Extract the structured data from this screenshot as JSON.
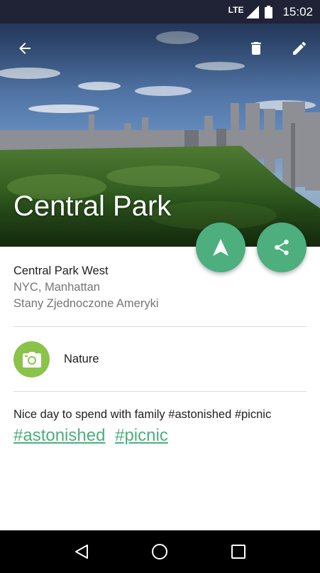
{
  "status_bar": {
    "network": "LTE",
    "time": "15:02"
  },
  "toolbar": {
    "back_icon": "arrow-back-icon",
    "delete_icon": "trash-icon",
    "edit_icon": "pencil-icon"
  },
  "hero": {
    "title": "Central Park",
    "image": "central-park-skyline-photo"
  },
  "fabs": {
    "navigate_icon": "navigation-arrow-icon",
    "share_icon": "share-icon",
    "color": "#4caf7d"
  },
  "address": {
    "street": "Central Park West",
    "city": "NYC, Manhattan",
    "country": "Stany Zjednoczone Ameryki"
  },
  "category": {
    "icon": "camera-icon",
    "label": "Nature",
    "color": "#8bc34a"
  },
  "note": {
    "description": "Nice day to spend with family #astonished #picnic",
    "tags": [
      "#astonished",
      "#picnic"
    ]
  },
  "nav_bar": {
    "back_icon": "triangle-back-icon",
    "home_icon": "circle-home-icon",
    "recents_icon": "square-recents-icon"
  }
}
